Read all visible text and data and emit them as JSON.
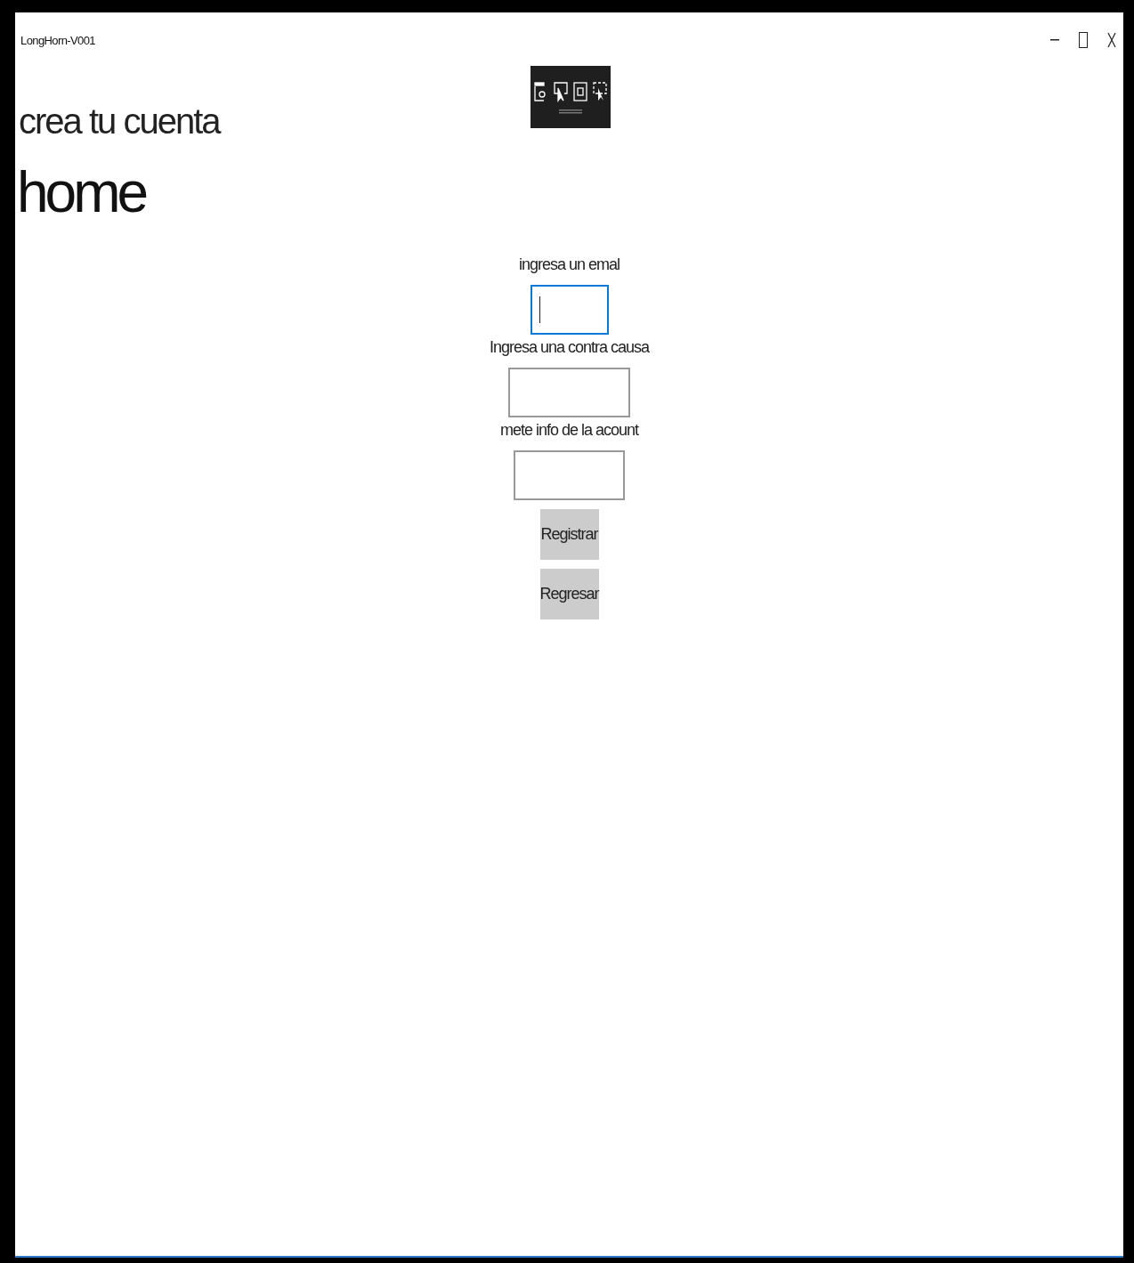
{
  "window": {
    "title": "LongHorn-V001"
  },
  "headings": [
    "crea tu cuenta",
    "home"
  ],
  "form": {
    "fields": [
      {
        "label": "ingresa un emal",
        "focused": true
      },
      {
        "label": "Ingresa una contra causa",
        "focused": false
      },
      {
        "label": "mete info de la acount",
        "focused": false
      }
    ],
    "buttons": [
      "Registrar",
      "Regresar"
    ]
  }
}
